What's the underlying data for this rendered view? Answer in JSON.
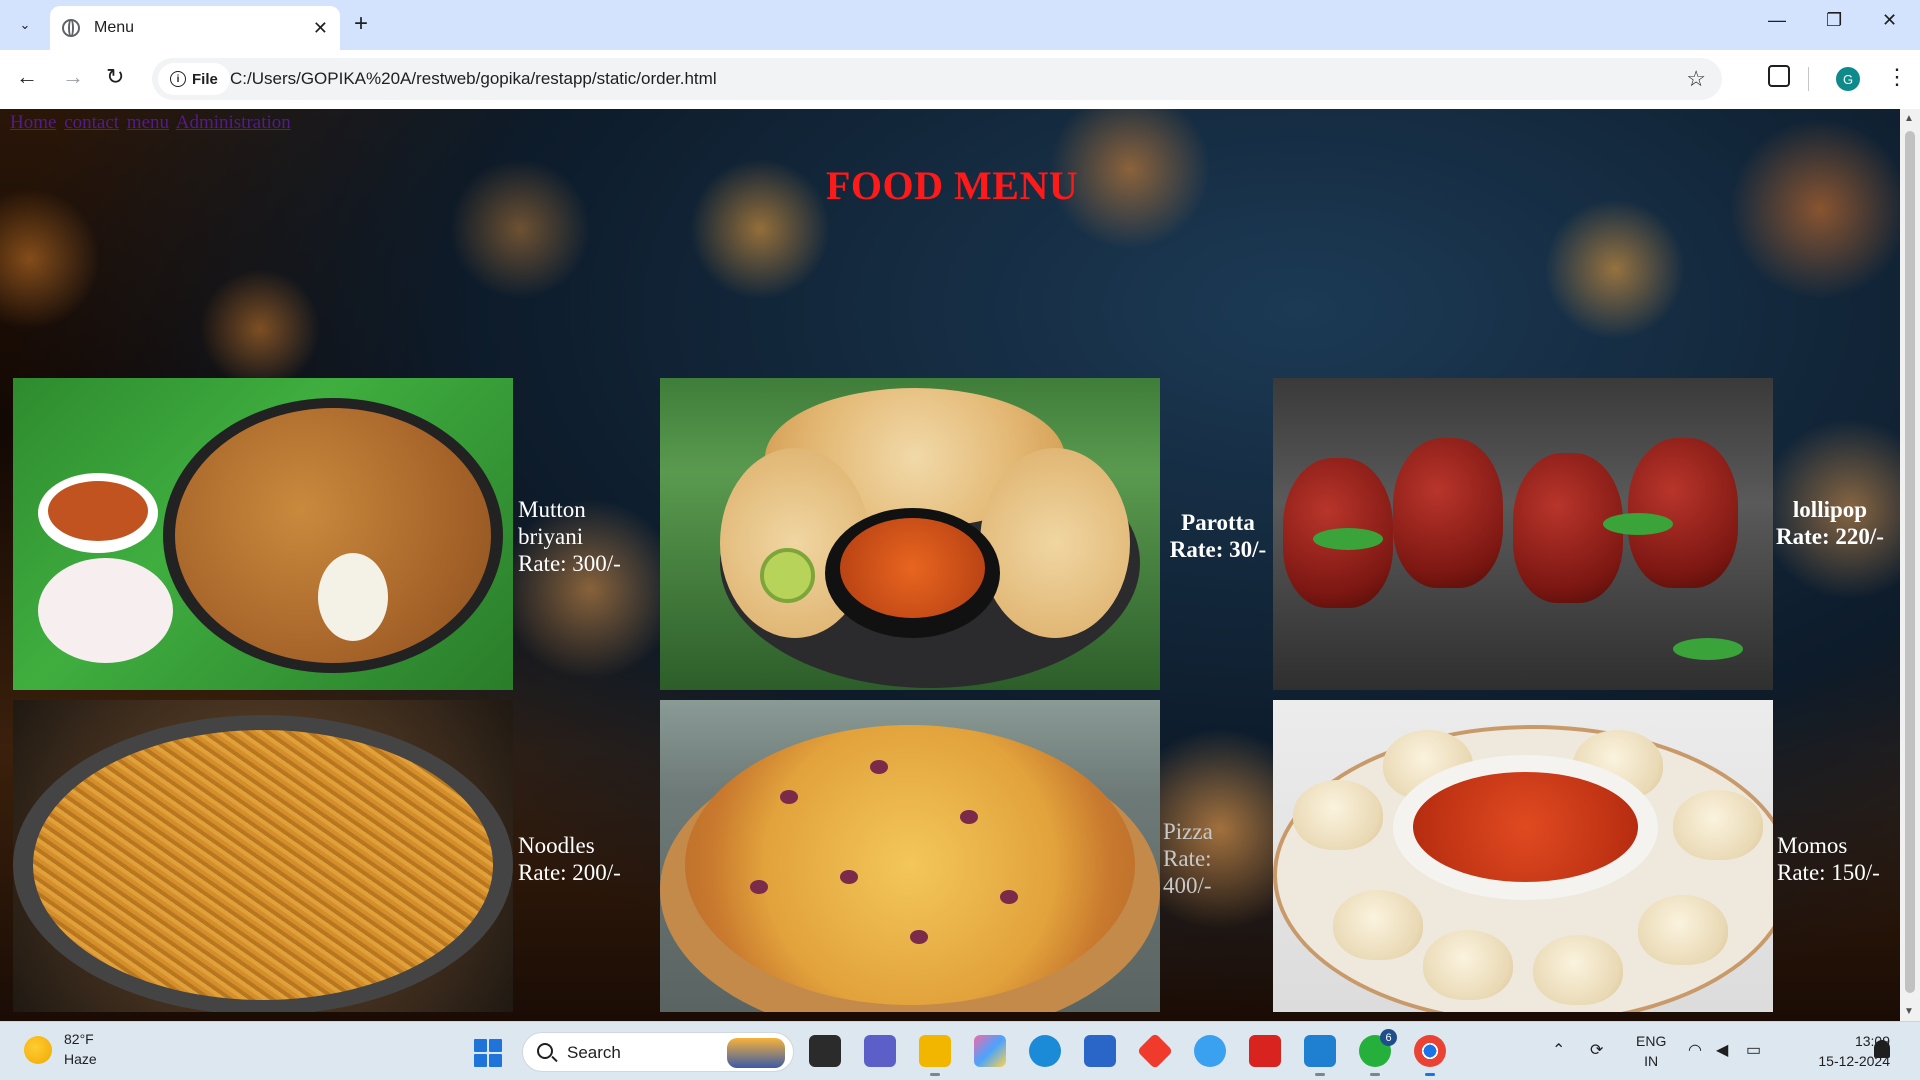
{
  "browser": {
    "tab_title": "Menu",
    "url_scheme_label": "File",
    "url": "C:/Users/GOPIKA%20A/restweb/gopika/restapp/static/order.html",
    "profile_initial": "G"
  },
  "page": {
    "nav": [
      "Home",
      "contact",
      "menu",
      "Administration"
    ],
    "title": "FOOD MENU",
    "items": [
      {
        "name": "Mutton briyani",
        "rate": "Rate: 300/-"
      },
      {
        "name": "Parotta",
        "rate": "Rate: 30/-"
      },
      {
        "name": "lollipop",
        "rate": "Rate: 220/-"
      },
      {
        "name": "Noodles",
        "rate": "Rate: 200/-"
      },
      {
        "name": "Pizza",
        "rate": "Rate: 400/-"
      },
      {
        "name": "Momos",
        "rate": "Rate: 150/-"
      }
    ]
  },
  "taskbar": {
    "weather_temp": "82°F",
    "weather_desc": "Haze",
    "search_placeholder": "Search",
    "lang_top": "ENG",
    "lang_bottom": "IN",
    "time": "13:09",
    "date": "15-12-2024",
    "whatsapp_badge": "6"
  },
  "colors": {
    "title_red": "#ff1a1a",
    "link_visited": "#551a8b",
    "tabstrip": "#d3e3fd"
  }
}
